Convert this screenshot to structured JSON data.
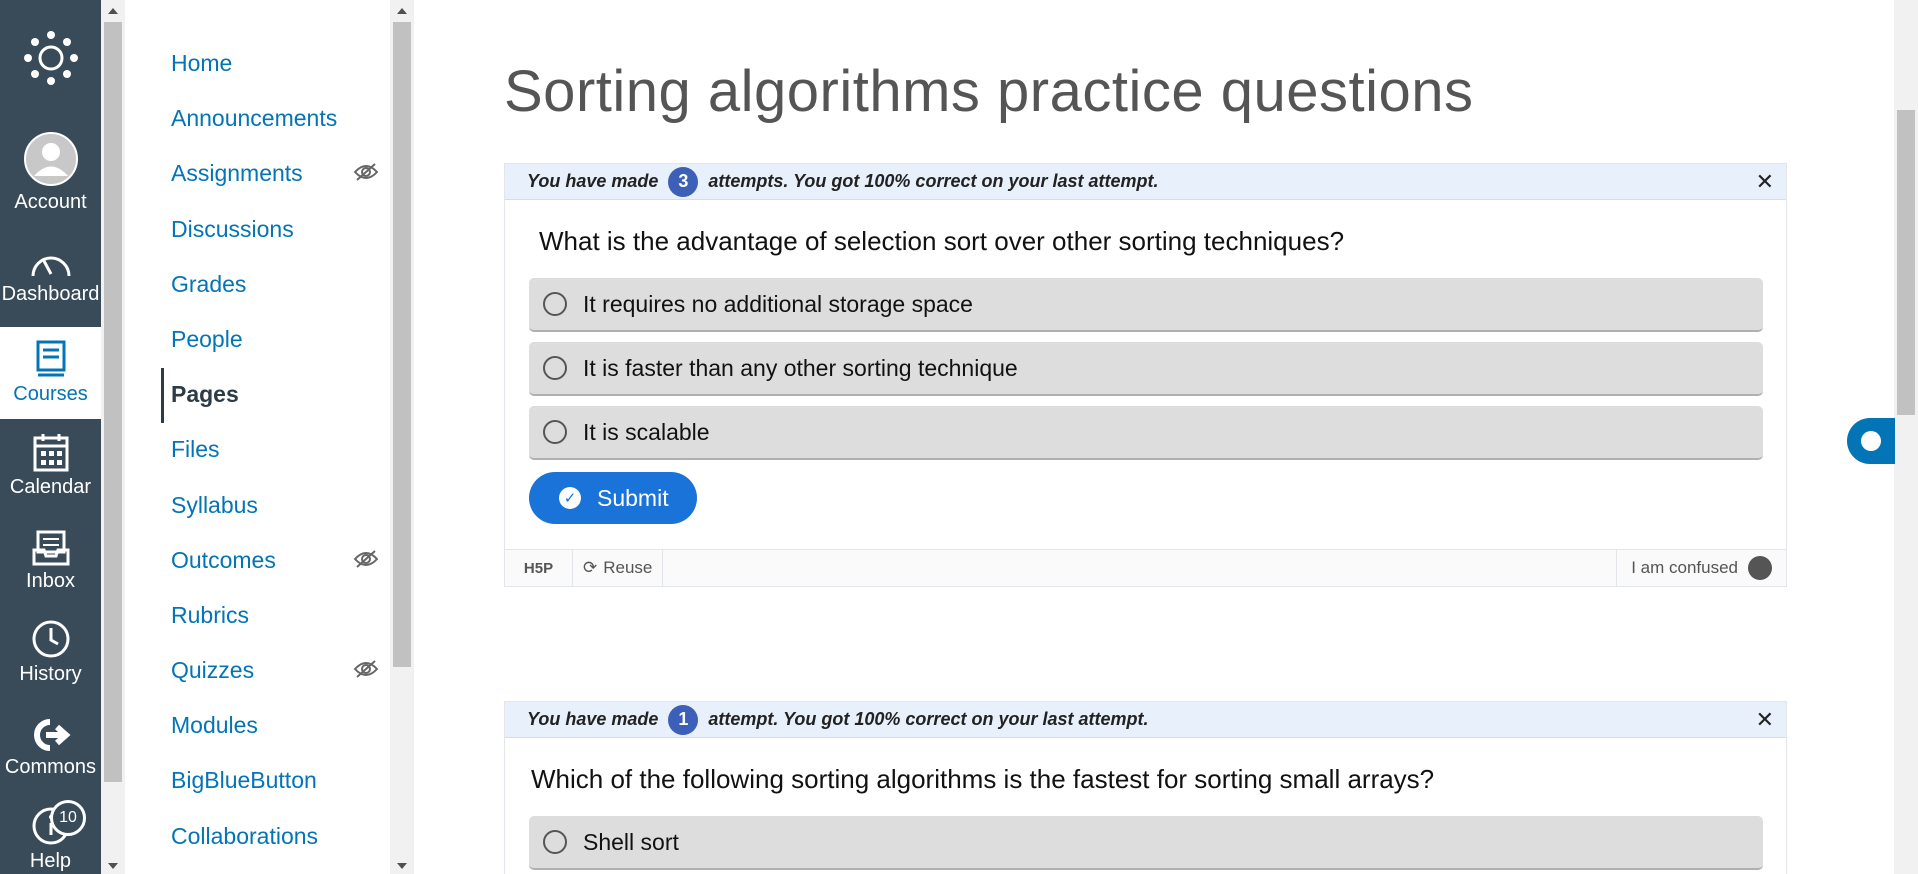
{
  "global_nav": {
    "items": [
      {
        "label": "Account",
        "icon": "account-avatar-icon"
      },
      {
        "label": "Dashboard",
        "icon": "dashboard-icon"
      },
      {
        "label": "Courses",
        "icon": "courses-icon",
        "active": true
      },
      {
        "label": "Calendar",
        "icon": "calendar-icon"
      },
      {
        "label": "Inbox",
        "icon": "inbox-icon"
      },
      {
        "label": "History",
        "icon": "history-icon"
      },
      {
        "label": "Commons",
        "icon": "commons-icon"
      },
      {
        "label": "Help",
        "icon": "help-icon",
        "badge": "10"
      }
    ]
  },
  "course_nav": {
    "items": [
      {
        "label": "Home"
      },
      {
        "label": "Announcements"
      },
      {
        "label": "Assignments",
        "hidden_from_students": true
      },
      {
        "label": "Discussions"
      },
      {
        "label": "Grades"
      },
      {
        "label": "People"
      },
      {
        "label": "Pages",
        "active": true
      },
      {
        "label": "Files"
      },
      {
        "label": "Syllabus"
      },
      {
        "label": "Outcomes",
        "hidden_from_students": true
      },
      {
        "label": "Rubrics"
      },
      {
        "label": "Quizzes",
        "hidden_from_students": true
      },
      {
        "label": "Modules"
      },
      {
        "label": "BigBlueButton"
      },
      {
        "label": "Collaborations"
      }
    ]
  },
  "page": {
    "title": "Sorting algorithms practice questions"
  },
  "questions": [
    {
      "attempts_prefix": "You have made",
      "attempts_count": "3",
      "attempts_suffix": "attempts.  You got 100% correct on your last attempt.",
      "question": "What is the advantage of selection sort over other sorting techniques?",
      "options": [
        "It requires no additional storage space",
        "It is faster than any other sorting technique",
        "It is scalable"
      ],
      "submit_label": "Submit",
      "footer": {
        "logo": "H5P",
        "reuse": "Reuse",
        "confused": "I am confused"
      }
    },
    {
      "attempts_prefix": "You have made",
      "attempts_count": "1",
      "attempts_suffix": "attempt.  You got 100% correct on your last attempt.",
      "question": "Which of the following sorting algorithms is the fastest for sorting small arrays?",
      "options": [
        "Shell sort"
      ]
    }
  ],
  "colors": {
    "nav_bg": "#394b58",
    "link": "#0374b5",
    "submit": "#1a73d9",
    "attempts_badge": "#3c5fb8"
  }
}
